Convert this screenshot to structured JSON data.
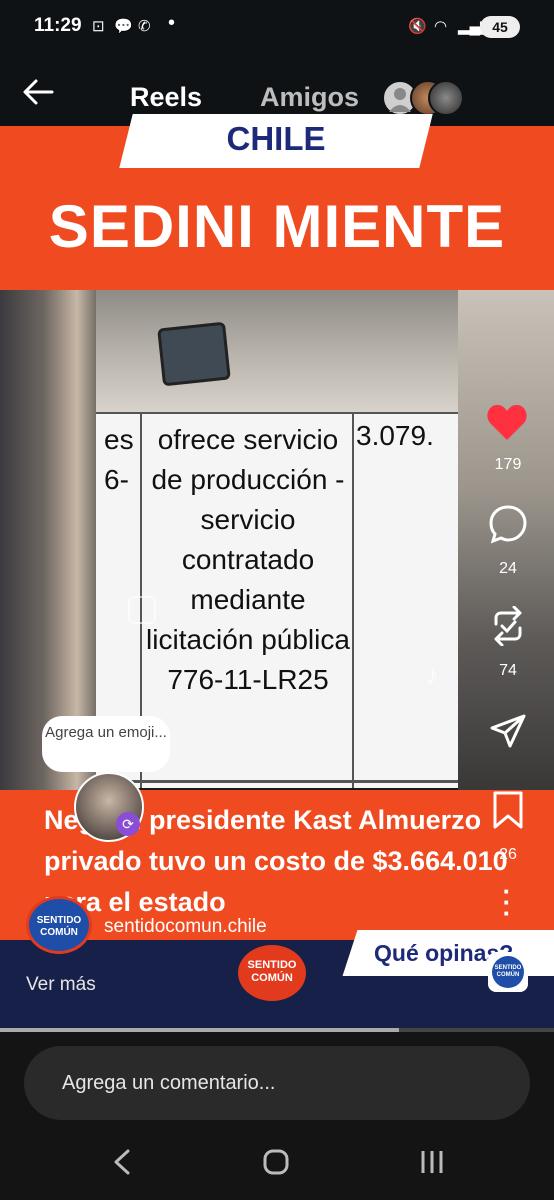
{
  "status_bar": {
    "time": "11:29",
    "battery": "45"
  },
  "nav": {
    "tab_reels": "Reels",
    "tab_friends": "Amigos"
  },
  "video": {
    "banner_country": "CHILE",
    "headline": "SEDINI MIENTE",
    "document": {
      "left_column": "es\n6-",
      "center_text": "ofrece servicio de producción - servicio contratado mediante licitación pública 776-11-LR25",
      "right_column": "3.079."
    },
    "subtitle": "Negó el presidente Kast Almuerzo privado tuvo un costo de $3.664.010 para el estado",
    "question": "Qué opinas?",
    "logo_text": "SENTIDO COMÚN"
  },
  "actions": {
    "likes": "179",
    "comments": "24",
    "reposts": "74",
    "saves": "26"
  },
  "author": {
    "name": "sentidocomun.chile",
    "logo_text": "SENTIDO COMÚN",
    "see_more": "Ver más"
  },
  "emoji_prompt": "Agrega un emoji...",
  "comment_placeholder": "Agrega un comentario...",
  "progress": 0.72,
  "colors": {
    "orange": "#f04a20",
    "navy": "#162049",
    "like_red": "#ff3040"
  }
}
